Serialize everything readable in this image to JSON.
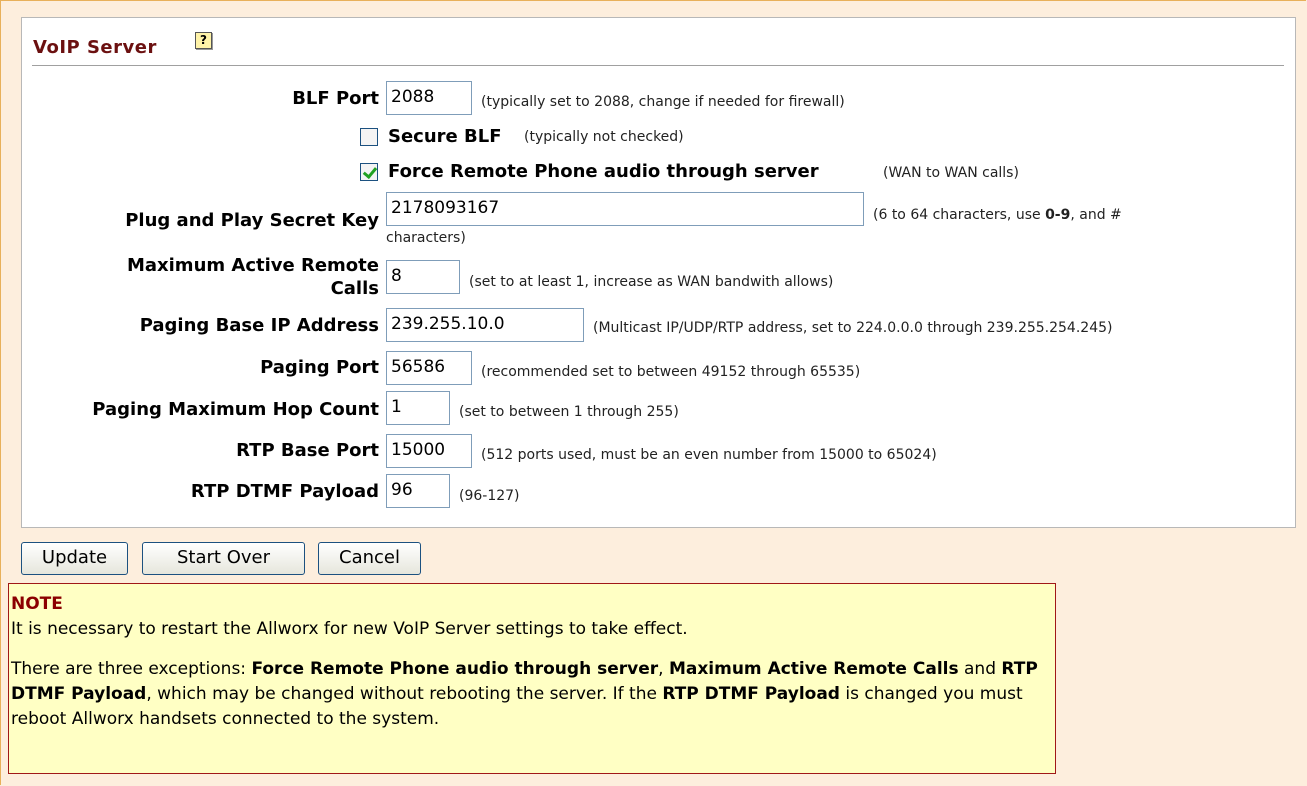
{
  "panel": {
    "title": "VoIP Server",
    "help_icon": "help-icon"
  },
  "fields": {
    "blf_port": {
      "label": "BLF Port",
      "value": "2088",
      "hint": "(typically set to 2088, change if needed for firewall)"
    },
    "secure_blf": {
      "label": "Secure BLF",
      "checked": false,
      "hint": "(typically not checked)"
    },
    "force_remote": {
      "label": "Force Remote Phone audio through server",
      "checked": true,
      "hint": "(WAN to WAN calls)"
    },
    "pnp_key": {
      "label": "Plug and Play Secret Key",
      "value": "2178093167",
      "hint_a": "(6 to 64 characters, use ",
      "hint_bold": "0-9",
      "hint_b": ", and #",
      "hint_line2": "characters)"
    },
    "max_calls": {
      "label_line1": "Maximum Active Remote",
      "label_line2": "Calls",
      "value": "8",
      "hint": "(set to at least 1, increase as WAN bandwith allows)"
    },
    "paging_ip": {
      "label": "Paging Base IP Address",
      "value": "239.255.10.0",
      "hint": "(Multicast IP/UDP/RTP address, set to 224.0.0.0 through 239.255.254.245)"
    },
    "paging_port": {
      "label": "Paging Port",
      "value": "56586",
      "hint": "(recommended set to between 49152 through 65535)"
    },
    "hop_count": {
      "label": "Paging Maximum Hop Count",
      "value": "1",
      "hint": "(set to between 1 through 255)"
    },
    "rtp_port": {
      "label": "RTP Base Port",
      "value": "15000",
      "hint": "(512 ports used, must be an even number from 15000 to 65024)"
    },
    "dtmf": {
      "label": "RTP DTMF Payload",
      "value": "96",
      "hint": "(96-127)"
    }
  },
  "buttons": {
    "update": "Update",
    "start_over": "Start Over",
    "cancel": "Cancel"
  },
  "note": {
    "title": "NOTE",
    "line1": "It is necessary to restart the Allworx for new VoIP Server settings to take effect.",
    "p2_a": "There are three exceptions: ",
    "p2_b1": "Force Remote Phone audio through server",
    "p2_c": ", ",
    "p2_b2": "Maximum Active Remote Calls",
    "p2_d": " and ",
    "p2_b3": "RTP DTMF Payload",
    "p2_e": ", which may be changed without rebooting the server. If the ",
    "p2_b4": "RTP DTMF Payload",
    "p2_f": " is changed you must reboot Allworx handsets connected to the system."
  }
}
